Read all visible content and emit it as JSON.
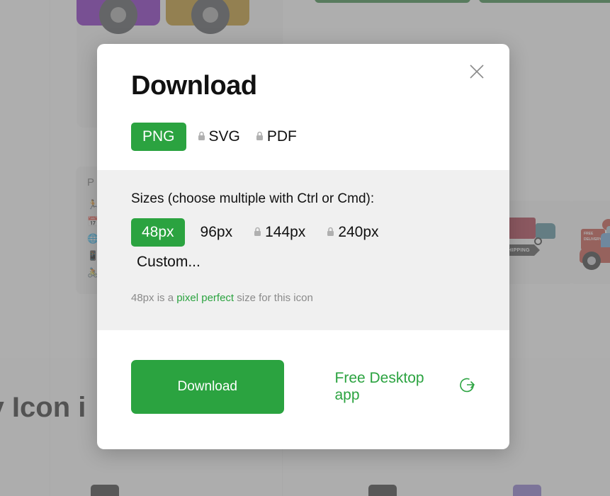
{
  "modal": {
    "title": "Download",
    "close_icon": "close-icon",
    "formats": [
      {
        "label": "PNG",
        "locked": false,
        "selected": true
      },
      {
        "label": "SVG",
        "locked": true,
        "selected": false
      },
      {
        "label": "PDF",
        "locked": true,
        "selected": false
      }
    ],
    "sizes_label": "Sizes (choose multiple with Ctrl or Cmd):",
    "sizes": [
      {
        "label": "48px",
        "locked": false,
        "selected": true
      },
      {
        "label": "96px",
        "locked": false,
        "selected": false
      },
      {
        "label": "144px",
        "locked": true,
        "selected": false
      },
      {
        "label": "240px",
        "locked": true,
        "selected": false
      }
    ],
    "custom_label": "Custom...",
    "pixel_note": {
      "prefix": "48px is a ",
      "highlight": "pixel perfect",
      "suffix": " size for this icon"
    },
    "download_label": "Download",
    "desktop_app_label": "Free Desktop app",
    "desktop_app_icon": "arrow-circle-right-icon"
  },
  "background": {
    "list_panel": {
      "title": "P",
      "rows": [
        {
          "glyph": "🏃"
        },
        {
          "glyph": "📅"
        },
        {
          "glyph": "🌐"
        },
        {
          "glyph": "📱"
        },
        {
          "glyph": "🚴"
        }
      ]
    },
    "heading": "ry Icon i",
    "shipping_banner": "SHIPPING",
    "rider_box_text": "FREE DELIVERY",
    "tiles": [
      {
        "color": "#7209B7"
      },
      {
        "color": "#B8860B"
      }
    ],
    "top_buttons": [
      {
        "color": "#1d7a2e"
      },
      {
        "color": "#1d7a2e"
      }
    ]
  },
  "colors": {
    "accent_green": "#2ba340",
    "dim_overlay": "rgba(125,125,125,0.62)",
    "panel_grey": "#f0f0f0",
    "muted_text": "#8a8a8a"
  }
}
